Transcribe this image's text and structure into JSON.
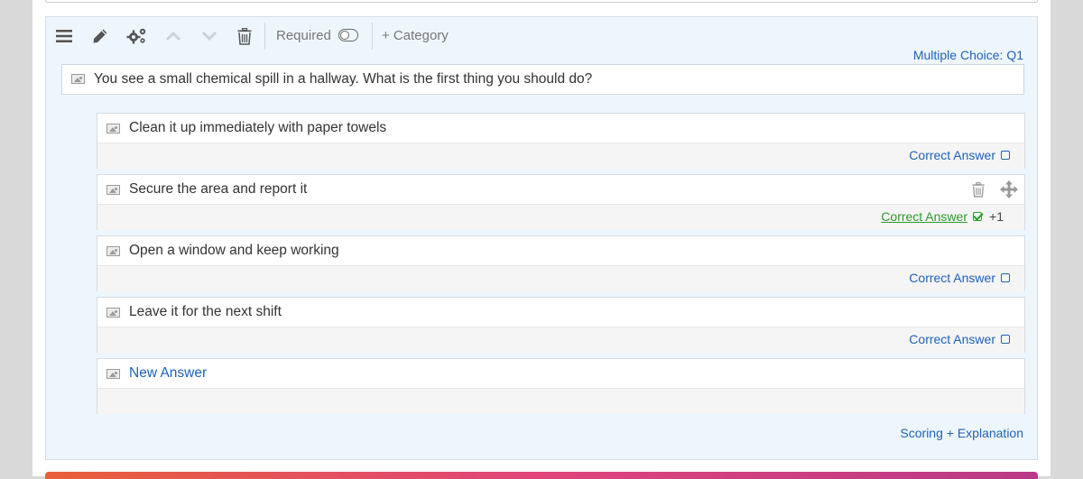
{
  "toolbar": {
    "menu_icon": "hamburger-icon",
    "edit_icon": "pencil-icon",
    "settings_icon": "gears-icon",
    "up_icon": "chevron-up-icon",
    "down_icon": "chevron-down-icon",
    "delete_icon": "trash-icon",
    "required_label": "Required",
    "category_label": "+ Category"
  },
  "question": {
    "type_label": "Multiple Choice: Q1",
    "text": "You see a small chemical spill in a hallway. What is the first thing you should do?"
  },
  "answers": [
    {
      "text": "Clean it up immediately with paper towels",
      "correct_label": "Correct Answer",
      "correct": false
    },
    {
      "text": "Secure the area and report it",
      "correct_label": "Correct Answer",
      "correct": true,
      "score": "+1"
    },
    {
      "text": "Open a window and keep working",
      "correct_label": "Correct Answer",
      "correct": false
    },
    {
      "text": "Leave it for the next shift",
      "correct_label": "Correct Answer",
      "correct": false
    }
  ],
  "new_answer_label": "New Answer",
  "scoring_label": "Scoring + Explanation",
  "colors": {
    "accent": "#1f62b8",
    "correct": "#2c9a2c",
    "card_bg": "#eef6fd"
  }
}
